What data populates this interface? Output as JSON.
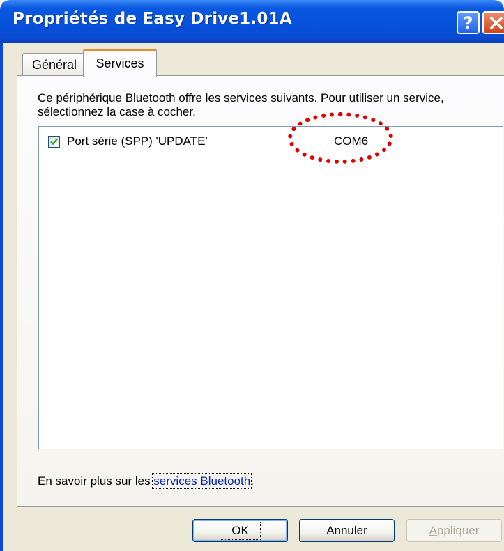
{
  "window": {
    "title": "Propriétés de Easy Drive1.01A",
    "help_glyph": "?",
    "close_glyph": "✕"
  },
  "tabs": [
    {
      "label": "Général",
      "selected": false
    },
    {
      "label": "Services",
      "selected": true
    }
  ],
  "services_panel": {
    "description": "Ce périphérique Bluetooth offre les services suivants. Pour utiliser un service, sélectionnez la case à cocher.",
    "services": [
      {
        "name": "Port série (SPP) 'UPDATE'",
        "port": "COM6",
        "checked": true
      }
    ],
    "learn_more_prefix": "En savoir plus sur les ",
    "learn_more_link": "services Bluetooth",
    "learn_more_suffix": "."
  },
  "buttons": {
    "ok": "OK",
    "cancel": "Annuler",
    "apply_first": "A",
    "apply_rest": "ppliquer",
    "apply_enabled": false
  },
  "colors": {
    "title_bar": "#0551dc",
    "dialog_bg": "#ece9d8",
    "active_tab_accent": "#e68b2c",
    "annotation": "#e00000",
    "link": "#0b2bb5"
  },
  "icons": {
    "checkbox_mark": "check-icon",
    "help": "help-icon",
    "close": "close-icon"
  }
}
